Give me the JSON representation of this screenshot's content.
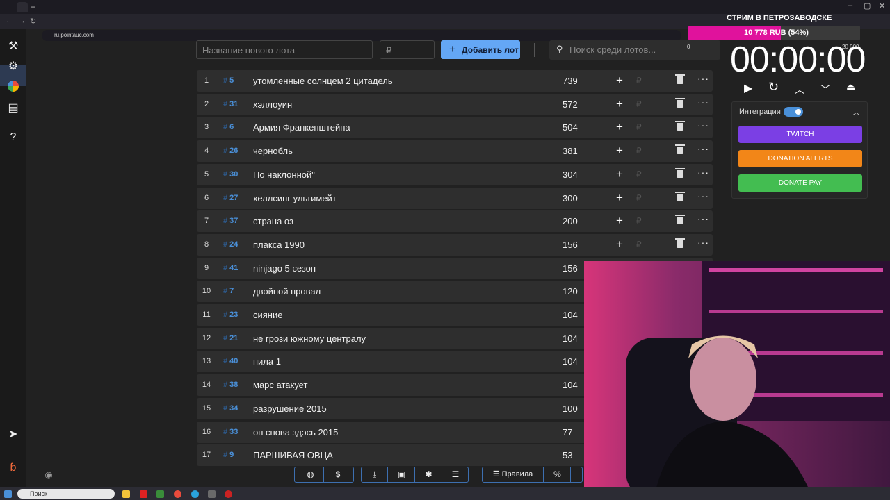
{
  "browser": {
    "url": "ru.pointauc.com",
    "new_tab": "+",
    "controls": [
      "–",
      "▢",
      "✕"
    ]
  },
  "toolbar": {
    "lot_name_placeholder": "Название нового лота",
    "amount_placeholder": "₽",
    "add_button_label": "Добавить лот",
    "search_placeholder": "Поиск среди лотов..."
  },
  "lots": [
    {
      "pos": "1",
      "id": "5",
      "name": "утомленные солнцем 2 цитадель",
      "amount": "739"
    },
    {
      "pos": "2",
      "id": "31",
      "name": "хэллоуин",
      "amount": "572"
    },
    {
      "pos": "3",
      "id": "6",
      "name": "Армия Франкенштейна",
      "amount": "504"
    },
    {
      "pos": "4",
      "id": "26",
      "name": "чернобль",
      "amount": "381"
    },
    {
      "pos": "5",
      "id": "30",
      "name": "По наклонной\"",
      "amount": "304"
    },
    {
      "pos": "6",
      "id": "27",
      "name": "хеллсинг ультимейт",
      "amount": "300"
    },
    {
      "pos": "7",
      "id": "37",
      "name": "страна оз",
      "amount": "200"
    },
    {
      "pos": "8",
      "id": "24",
      "name": "плакса 1990",
      "amount": "156"
    },
    {
      "pos": "9",
      "id": "41",
      "name": "ninjago 5 сезон",
      "amount": "156"
    },
    {
      "pos": "10",
      "id": "7",
      "name": " двойной провал",
      "amount": "120"
    },
    {
      "pos": "11",
      "id": "23",
      "name": "сияние",
      "amount": "104"
    },
    {
      "pos": "12",
      "id": "21",
      "name": "не грози южному централу",
      "amount": "104"
    },
    {
      "pos": "13",
      "id": "40",
      "name": "пила 1",
      "amount": "104"
    },
    {
      "pos": "14",
      "id": "38",
      "name": "марс атакует",
      "amount": "104"
    },
    {
      "pos": "15",
      "id": "34",
      "name": "разрушение 2015",
      "amount": "100"
    },
    {
      "pos": "16",
      "id": "33",
      "name": "он снова здэсь 2015",
      "amount": "77"
    },
    {
      "pos": "17",
      "id": "9",
      "name": "ПАРШИВАЯ ОВЦА",
      "amount": "53"
    }
  ],
  "row_actions": {
    "plus": "+",
    "rub": "₽",
    "more": "···",
    "hash": "#"
  },
  "bottom_bar": {
    "rules_label": "Правила",
    "percent_label": "%"
  },
  "overlay": {
    "title": "СТРИМ В ПЕТРОЗАВОДСКЕ",
    "progress_label": "10 778 RUB (54%)",
    "progress_fraction": 0.54,
    "min": "0",
    "max": "20 000",
    "timer": "00:00:00",
    "integrations_label": "Интеграции",
    "buttons": [
      "TWITCH",
      "DONATION ALERTS",
      "DONATE PAY"
    ]
  },
  "taskbar": {
    "search_label": "Поиск"
  },
  "colors": {
    "accent": "#64a7f5",
    "twitch": "#7b3fe4",
    "donation_alerts": "#f28618",
    "donate_pay": "#43bd51",
    "progress": "#e0129c"
  }
}
